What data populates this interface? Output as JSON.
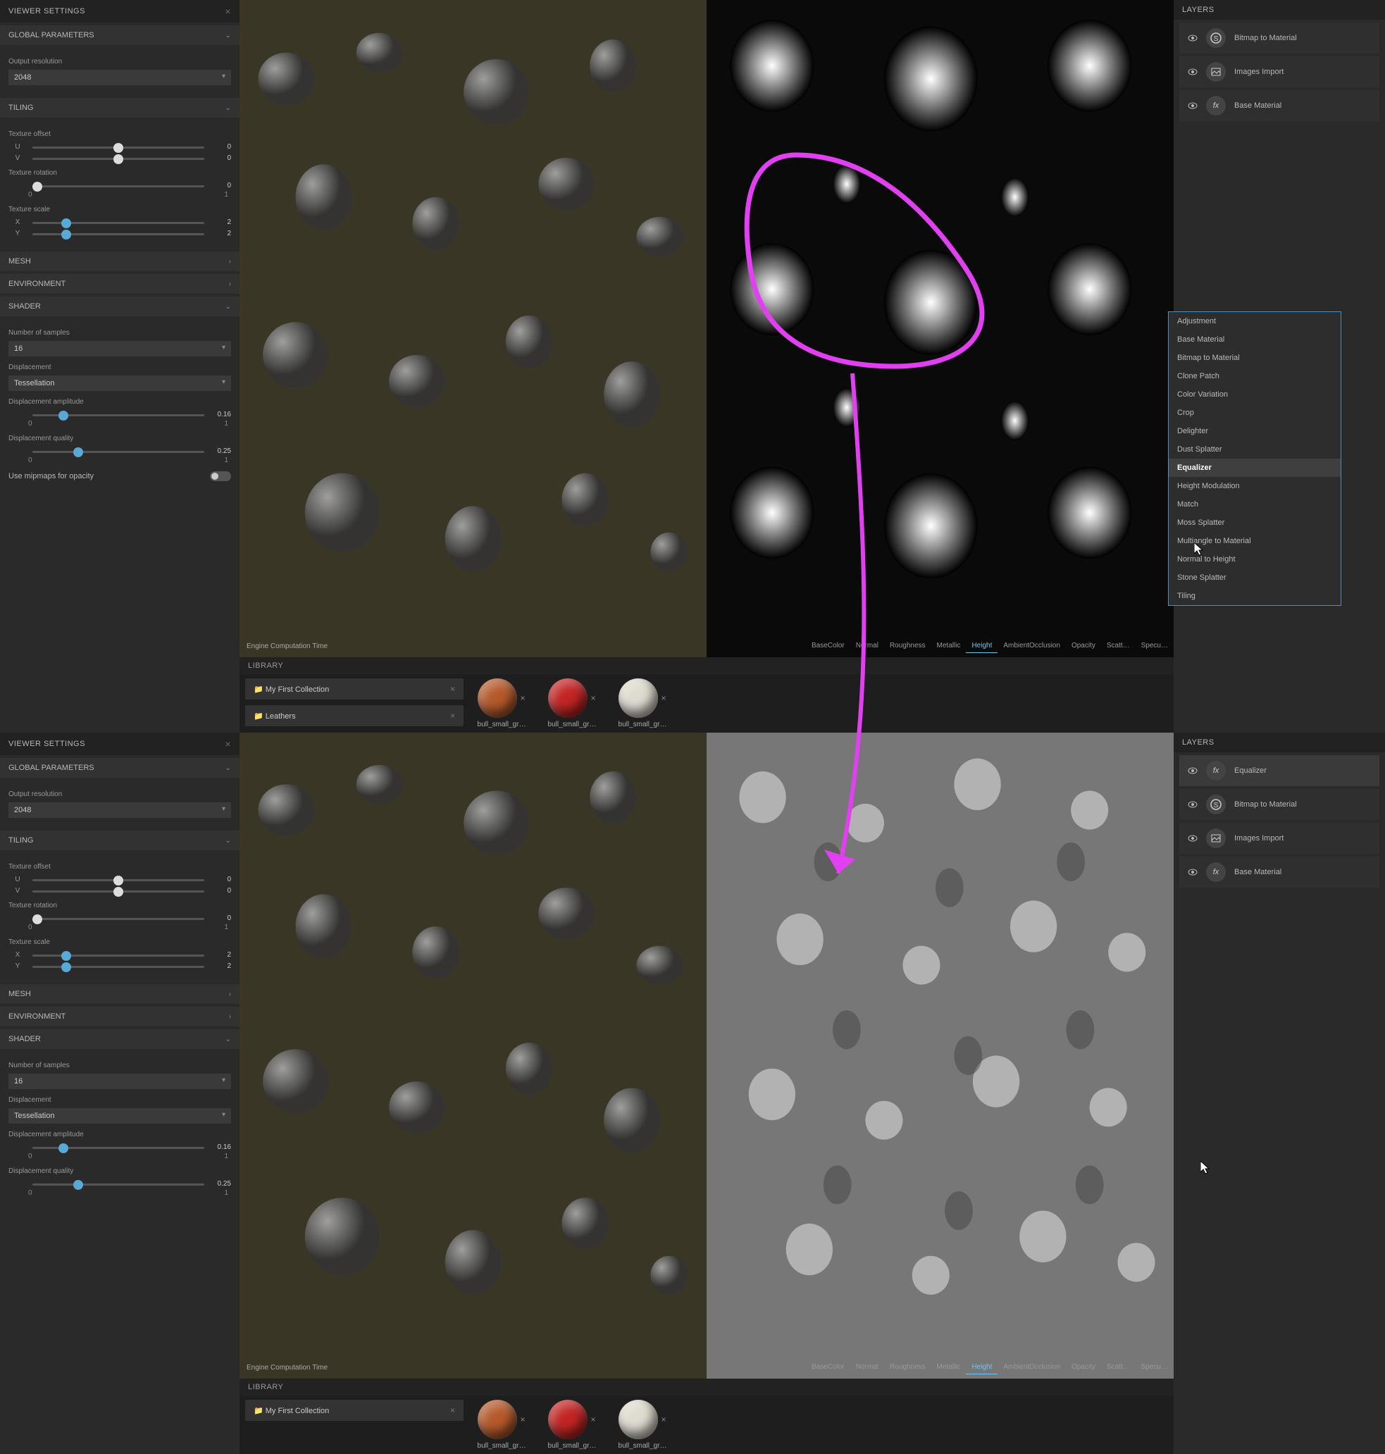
{
  "top": {
    "viewer": {
      "title": "VIEWER SETTINGS",
      "global": "GLOBAL PARAMETERS",
      "out_res_label": "Output resolution",
      "out_res_value": "2048",
      "tiling": "TILING",
      "tex_offset": "Texture offset",
      "u": "U",
      "v": "V",
      "offset_end": "0",
      "tex_rot": "Texture rotation",
      "rot_end": "0",
      "rot_min": "0",
      "rot_max": "1",
      "tex_scale": "Texture scale",
      "x": "X",
      "y": "Y",
      "scale_end": "2",
      "mesh": "MESH",
      "env": "ENVIRONMENT",
      "shader": "SHADER",
      "samples_label": "Number of samples",
      "samples_value": "16",
      "disp_label": "Displacement",
      "disp_value": "Tessellation",
      "amp_label": "Displacement amplitude",
      "amp_end": "0.16",
      "amp_min": "0",
      "amp_max": "1",
      "qual_label": "Displacement quality",
      "qual_end": "0.25",
      "qual_min": "0",
      "qual_max": "1",
      "mip_label": "Use mipmaps for opacity"
    },
    "viewport": {
      "ect": "Engine Computation Time",
      "tabs": [
        "BaseColor",
        "Normal",
        "Roughness",
        "Metallic",
        "Height",
        "AmbientOcclusion",
        "Opacity",
        "Scatt…",
        "Specu…"
      ],
      "active_tab": 4
    },
    "library": {
      "title": "LIBRARY",
      "tab1": "My First Collection",
      "tab2": "Leathers",
      "swatches": [
        {
          "name": "bull_small_gr…",
          "color": "#b55a2c"
        },
        {
          "name": "bull_small_gr…",
          "color": "#c22525"
        },
        {
          "name": "bull_small_gr…",
          "color": "#dedccf"
        }
      ]
    },
    "layers": {
      "title": "LAYERS",
      "items": [
        {
          "icon": "S",
          "label": "Bitmap to Material"
        },
        {
          "icon": "img",
          "label": "Images Import"
        },
        {
          "icon": "fx",
          "label": "Base Material"
        }
      ]
    },
    "context": {
      "items": [
        "Adjustment",
        "Base Material",
        "Bitmap to Material",
        "Clone Patch",
        "Color Variation",
        "Crop",
        "Delighter",
        "Dust Splatter",
        "Equalizer",
        "Height Modulation",
        "Match",
        "Moss Splatter",
        "Multiangle to Material",
        "Normal to Height",
        "Stone Splatter",
        "Tiling"
      ],
      "hover_index": 8
    }
  },
  "bottom": {
    "viewer": {
      "title": "VIEWER SETTINGS",
      "global": "GLOBAL PARAMETERS",
      "out_res_label": "Output resolution",
      "out_res_value": "2048",
      "tiling": "TILING",
      "tex_offset": "Texture offset",
      "u": "U",
      "v": "V",
      "offset_end": "0",
      "tex_rot": "Texture rotation",
      "rot_end": "0",
      "rot_min": "0",
      "rot_max": "1",
      "tex_scale": "Texture scale",
      "x": "X",
      "y": "Y",
      "scale_end": "2",
      "mesh": "MESH",
      "env": "ENVIRONMENT",
      "shader": "SHADER",
      "samples_label": "Number of samples",
      "samples_value": "16",
      "disp_label": "Displacement",
      "disp_value": "Tessellation",
      "amp_label": "Displacement amplitude",
      "amp_end": "0.16",
      "amp_min": "0",
      "amp_max": "1",
      "qual_label": "Displacement quality",
      "qual_end": "0.25",
      "qual_min": "0",
      "qual_max": "1"
    },
    "viewport": {
      "ect": "Engine Computation Time",
      "tabs": [
        "BaseColor",
        "Normal",
        "Roughness",
        "Metallic",
        "Height",
        "AmbientOcclusion",
        "Opacity",
        "Scatt…",
        "Specu…"
      ],
      "active_tab": 4
    },
    "library": {
      "title": "LIBRARY",
      "tab1": "My First Collection"
    },
    "layers": {
      "title": "LAYERS",
      "items": [
        {
          "icon": "fx",
          "label": "Equalizer"
        },
        {
          "icon": "S",
          "label": "Bitmap to Material"
        },
        {
          "icon": "img",
          "label": "Images Import"
        },
        {
          "icon": "fx",
          "label": "Base Material"
        }
      ],
      "active_index": 0
    }
  }
}
